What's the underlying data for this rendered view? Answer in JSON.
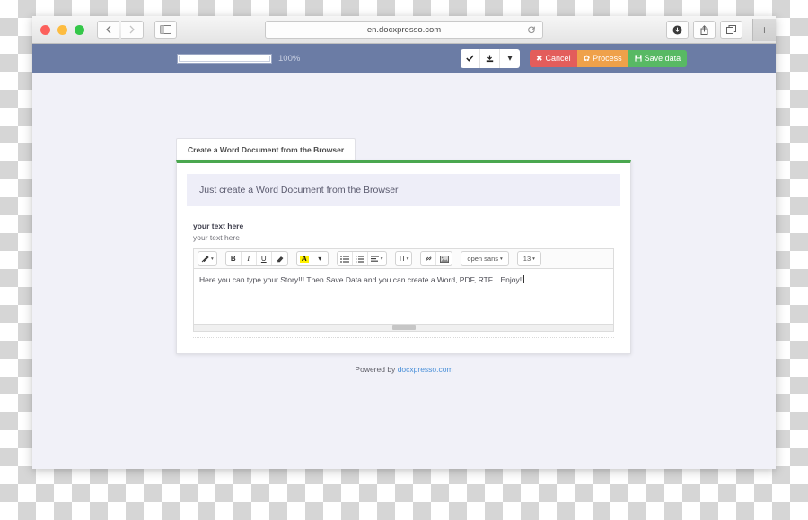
{
  "browser": {
    "url": "en.docxpresso.com",
    "back_icon": "chevron-left-icon",
    "forward_icon": "chevron-right-icon",
    "sidebar_icon": "sidebar-toggle-icon",
    "reload_icon": "reload-icon",
    "downloads_icon": "downloads-icon",
    "share_icon": "share-icon",
    "tabs_icon": "show-tabs-icon",
    "new_tab_label": "+"
  },
  "app_toolbar": {
    "progress_value": 100,
    "progress_label": "100%",
    "confirm_icon": "check-icon",
    "download_icon": "download-icon",
    "download_caret": "▾",
    "cancel_label": "Cancel",
    "cancel_icon": "close-x-icon",
    "cancel_color": "#e35d5b",
    "process_label": "Process",
    "process_icon": "gear-icon",
    "process_color": "#efa14a",
    "save_label": "Save data",
    "save_icon": "floppy-save-icon",
    "save_color": "#58b964"
  },
  "document": {
    "tab_label": "Create a Word Document from the Browser",
    "tab_accent_color": "#4aa74f",
    "banner_text": "Just create a Word Document from the Browser",
    "field_label": "your text here",
    "field_sublabel": "your text here",
    "editor_content": "Here you can type your Story!!! Then Save Data and you can create a Word, PDF, RTF... Enjoy!!"
  },
  "editor_toolbar": {
    "style_brush": "A",
    "bold": "B",
    "italic": "I",
    "underline": "U",
    "eraser": "remove-format-icon",
    "highlight": "A",
    "highlight_color": "#fff200",
    "bullet_list": "bulleted-list-icon",
    "numbered_list": "numbered-list-icon",
    "align": "align-icon",
    "text_style": "TI",
    "link": "link-icon",
    "image": "image-icon",
    "font_family": "open sans",
    "font_size": "13",
    "caret": "▾"
  },
  "footer": {
    "powered_prefix": "Powered by",
    "powered_link": "docxpresso.com"
  }
}
